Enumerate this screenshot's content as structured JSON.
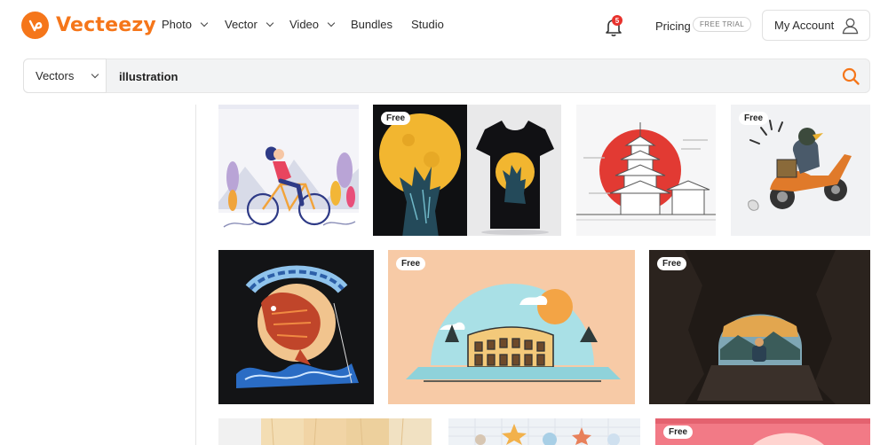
{
  "brand": {
    "name": "Vecteezy",
    "logo_letter": "V",
    "accent": "#f5761a"
  },
  "nav": {
    "photo": "Photo",
    "vector": "Vector",
    "video": "Video",
    "bundles": "Bundles",
    "studio": "Studio"
  },
  "notifications": {
    "count": "5"
  },
  "pricing": {
    "label": "Pricing",
    "badge": "FREE TRIAL"
  },
  "account": {
    "label": "My Account"
  },
  "search": {
    "category": "Vectors",
    "query": "illustration",
    "icon": "search-icon"
  },
  "results": {
    "free_label": "Free",
    "tiles": [
      {
        "name": "woman-bicycle",
        "free": false
      },
      {
        "name": "wolf-moon-tshirt",
        "free": true
      },
      {
        "name": "japan-pagoda-sun",
        "free": false
      },
      {
        "name": "bird-scooter",
        "free": true
      },
      {
        "name": "fishing-bass",
        "free": false
      },
      {
        "name": "colosseum",
        "free": true
      },
      {
        "name": "cave-view",
        "free": true
      },
      {
        "name": "wood-textures",
        "free": false
      },
      {
        "name": "starfish-shells",
        "free": false
      },
      {
        "name": "pink-landscape",
        "free": true
      }
    ]
  }
}
